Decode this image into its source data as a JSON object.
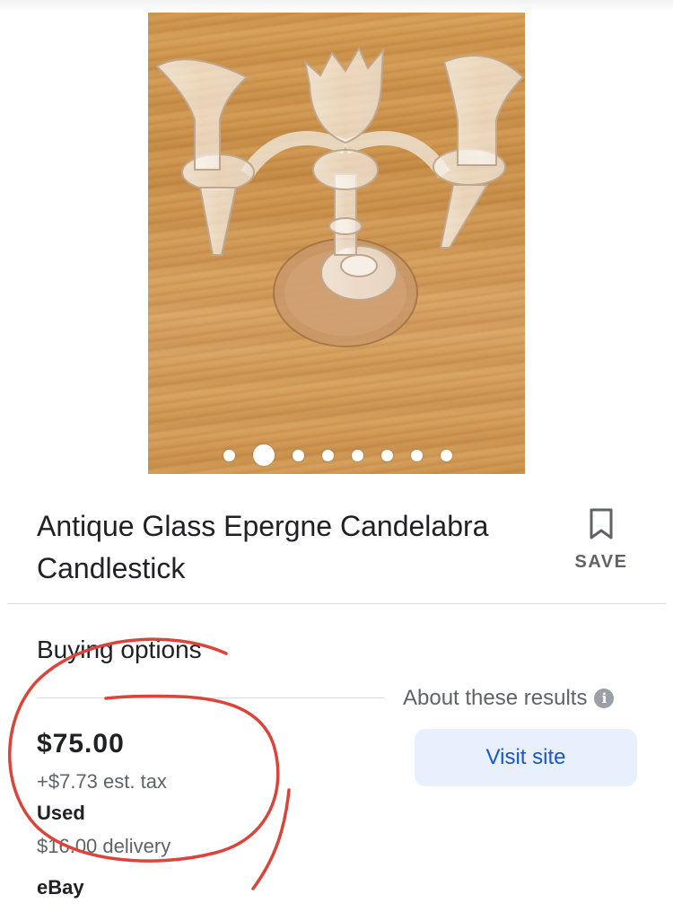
{
  "product": {
    "title": "Antique Glass Epergne Candelabra Candlestick",
    "image_count": 8,
    "active_image_index": 1
  },
  "save": {
    "label": "SAVE",
    "icon": "bookmark-icon"
  },
  "buying": {
    "title": "Buying options",
    "about_label": "About these results",
    "info_icon": "i"
  },
  "offer": {
    "price": "$75.00",
    "tax": "+$7.73 est. tax",
    "condition": "Used",
    "delivery": "$16.00 delivery",
    "seller": "eBay",
    "visit_label": "Visit site"
  },
  "colors": {
    "visit_bg": "#e8f0fe",
    "visit_text": "#1a56c9",
    "annotation": "#d9453a"
  }
}
